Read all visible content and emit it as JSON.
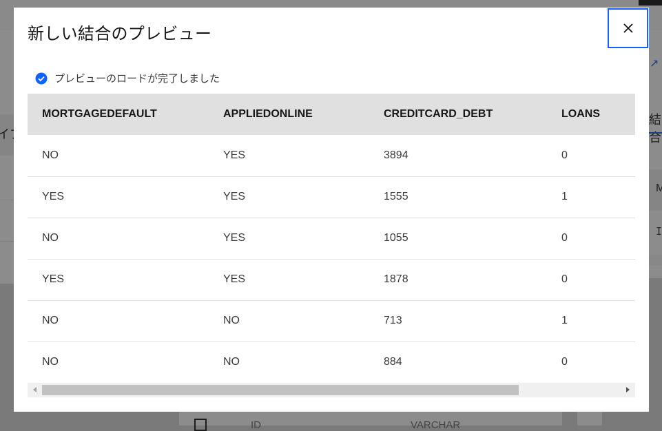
{
  "modal": {
    "title": "新しい結合のプレビュー",
    "status_text": "プレビューのロードが完了しました",
    "status_icon": "checkmark-filled-icon",
    "close_icon": "close-icon",
    "accent_color": "#0f62fe"
  },
  "table": {
    "columns": [
      "MORTGAGEDEFAULT",
      "APPLIEDONLINE",
      "CREDITCARD_DEBT",
      "LOANS"
    ],
    "rows": [
      [
        "NO",
        "YES",
        "3894",
        "0"
      ],
      [
        "YES",
        "YES",
        "1555",
        "1"
      ],
      [
        "NO",
        "YES",
        "1055",
        "0"
      ],
      [
        "YES",
        "YES",
        "1878",
        "0"
      ],
      [
        "NO",
        "NO",
        "713",
        "1"
      ],
      [
        "NO",
        "NO",
        "884",
        "0"
      ]
    ]
  },
  "background": {
    "left_fragment": "イブ",
    "right_fragment": "結合",
    "right_fragment2": "M",
    "right_fragment3": "I",
    "bottom_cells": [
      "ID",
      "VARCHAR"
    ]
  }
}
